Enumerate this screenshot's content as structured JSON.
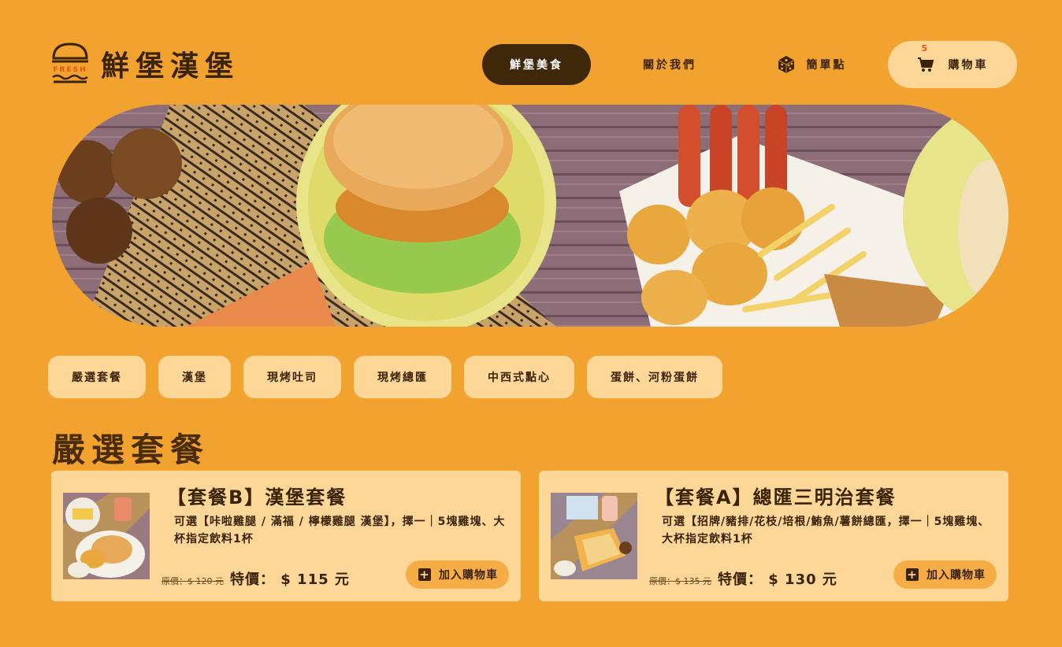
{
  "brand": {
    "logo_word": "FRESH",
    "name": "鮮堡漢堡"
  },
  "nav": {
    "items": [
      {
        "label": "鮮堡美食",
        "active": true
      },
      {
        "label": "關於我們",
        "active": false
      },
      {
        "label": "簡單點",
        "active": false,
        "icon": "dice-icon"
      }
    ],
    "cart": {
      "label": "購物車",
      "count": "5",
      "icon": "cart-icon"
    }
  },
  "categories": [
    "嚴選套餐",
    "漢堡",
    "現烤吐司",
    "現烤總匯",
    "中西式點心",
    "蛋餅、河粉蛋餅"
  ],
  "section": {
    "title": "嚴選套餐"
  },
  "products": [
    {
      "title": "【套餐B】漢堡套餐",
      "desc": "可選【咔啦雞腿 / 滿福 / 檸檬雞腿 漢堡】，擇一｜5塊雞塊、大杯指定飲料1杯",
      "orig_price": "原價：$ 120 元",
      "special_price": "特價： $ 115 元",
      "button": "加入購物車"
    },
    {
      "title": "【套餐A】總匯三明治套餐",
      "desc": "可選【招牌/豬排/花枝/培根/鮪魚/薯餅總匯，擇一｜5塊雞塊、大杯指定飲料1杯",
      "orig_price": "原價：$ 135 元",
      "special_price": "特價： $ 130 元",
      "button": "加入購物車"
    }
  ],
  "colors": {
    "background": "#f2a22f",
    "accent_dark": "#3f270a",
    "light": "#fdd798",
    "button": "#f6ad45"
  }
}
